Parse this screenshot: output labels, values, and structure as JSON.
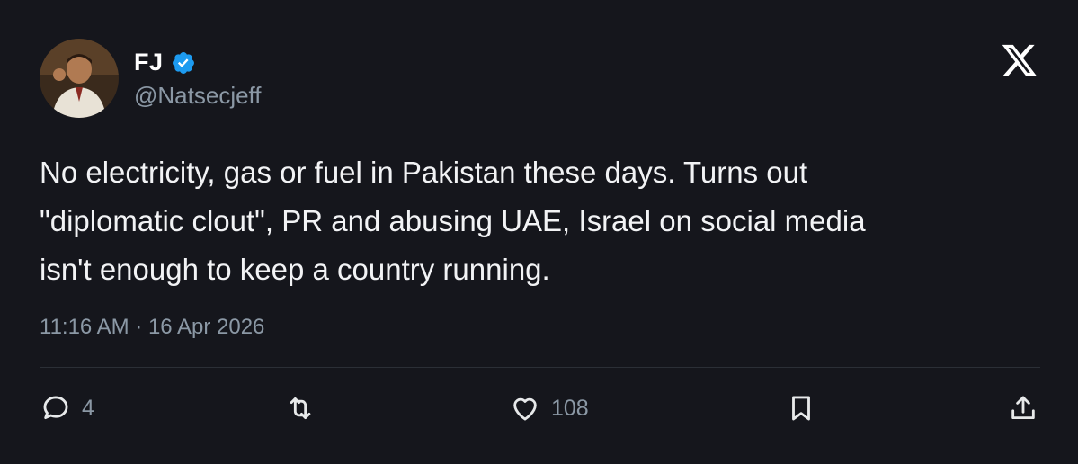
{
  "author": {
    "name": "FJ",
    "handle": "@Natsecjeff",
    "verified": true,
    "avatar_icon": "profile-photo"
  },
  "tweet": {
    "text": "No electricity, gas or fuel in Pakistan these days. Turns out\n\"diplomatic clout\", PR and abusing UAE, Israel on social media\nisn't enough to keep a country running.",
    "timestamp": "11:16 AM · 16 Apr 2026"
  },
  "actions": {
    "reply_count": "4",
    "like_count": "108"
  },
  "colors": {
    "background": "#15161c",
    "verified_blue": "#1d9bf0",
    "muted_text": "#8b98a5"
  }
}
